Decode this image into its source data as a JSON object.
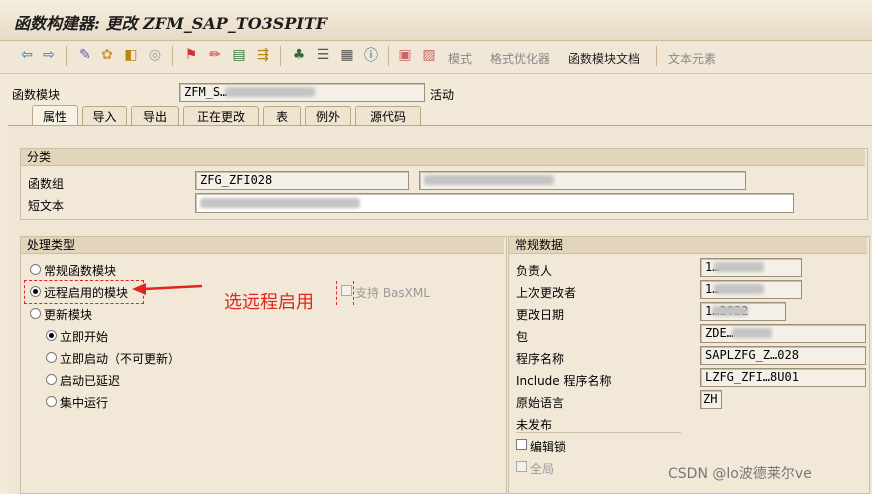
{
  "title": "函数构建器: 更改 ZFM_SAP_TO3SPITF",
  "toolbar": {
    "text_buttons": [
      "模式",
      "格式优化器",
      "函数模块文档",
      "文本元素"
    ]
  },
  "header": {
    "fm_label": "函数模块",
    "fm_value": "ZFM_S…",
    "status": "活动"
  },
  "tabs": [
    "属性",
    "导入",
    "导出",
    "正在更改",
    "表",
    "例外",
    "源代码"
  ],
  "classification": {
    "title": "分类",
    "group_label": "函数组",
    "group_value": "ZFG_ZFI028",
    "short_text_label": "短文本"
  },
  "processing": {
    "title": "处理类型",
    "options": [
      "常规函数模块",
      "远程启用的模块",
      "更新模块"
    ],
    "selected_index": 1,
    "support_basxml": "支持 BasXML",
    "update_options": [
      "立即开始",
      "立即启动（不可更新）",
      "启动已延迟",
      "集中运行"
    ],
    "update_selected_index": 0
  },
  "general": {
    "title": "常规数据",
    "rows": [
      {
        "label": "负责人",
        "value": "1…"
      },
      {
        "label": "上次更改者",
        "value": "1…"
      },
      {
        "label": "更改日期",
        "value": "1…2022"
      },
      {
        "label": "包",
        "value": "ZDE…"
      },
      {
        "label": "程序名称",
        "value": "SAPLZFG_Z…028"
      },
      {
        "label": "Include 程序名称",
        "value": "LZFG_ZFI…8U01"
      },
      {
        "label": "原始语言",
        "value": "ZH"
      }
    ],
    "unpublished": "未发布",
    "edit_lock": "编辑锁",
    "global": "全局"
  },
  "annotation": "选远程启用",
  "watermark": "CSDN @lo波德莱尔ve",
  "colors": {
    "annotation": "#e0261e",
    "panel_bg": "#f2e9d9"
  }
}
